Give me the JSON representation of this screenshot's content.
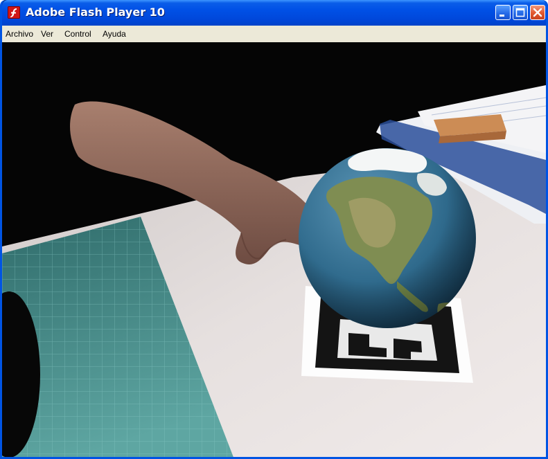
{
  "window": {
    "title": "Adobe Flash Player 10",
    "app_icon": "flash-player-icon",
    "caption_buttons": [
      "minimize-icon",
      "maximize-icon",
      "close-icon"
    ]
  },
  "menu": {
    "items": [
      {
        "label": "Archivo"
      },
      {
        "label": "Ver"
      },
      {
        "label": "Control"
      },
      {
        "label": "Ayuda"
      }
    ]
  },
  "stage": {
    "content": "augmented-reality-globe-on-marker"
  },
  "colors": {
    "titlebar": "#0050e6",
    "menubar": "#ece9d8",
    "close_button": "#e2572d",
    "ocean": "#2f6a8c"
  }
}
